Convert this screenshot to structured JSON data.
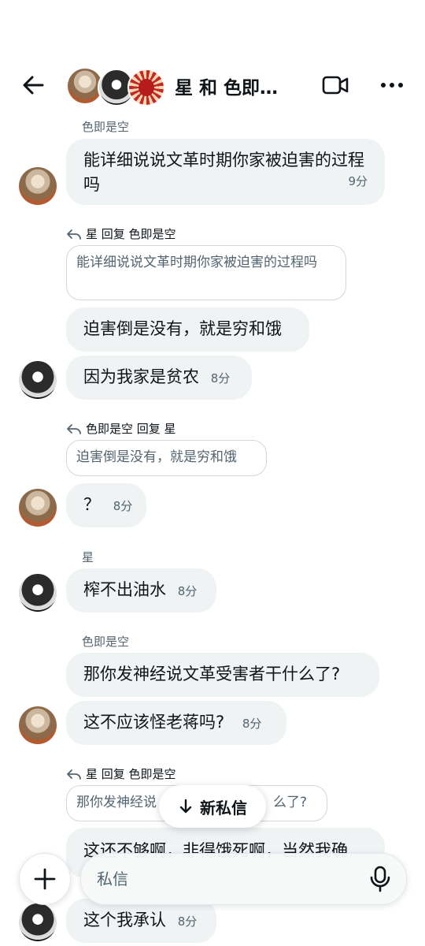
{
  "header": {
    "title": "星 和 色即…"
  },
  "composer": {
    "placeholder": "私信"
  },
  "new_messages_button": "新私信",
  "messages": [
    {
      "sender_label": "色即是空"
    },
    {
      "text": "能详细说说文革时期你家被迫害的过程吗",
      "time": "9分"
    },
    {
      "reply_label": "星 回复 色即是空",
      "quote": "能详细说说文革时期你家被迫害的过程吗"
    },
    {
      "text": "迫害倒是没有，就是穷和饿"
    },
    {
      "text": "因为我家是贫农",
      "time": "8分"
    },
    {
      "reply_label": "色即是空 回复 星",
      "quote": "迫害倒是没有，就是穷和饿"
    },
    {
      "text": "？",
      "time": "8分"
    },
    {
      "sender_label": "星"
    },
    {
      "text": "榨不出油水",
      "time": "8分"
    },
    {
      "sender_label": "色即是空"
    },
    {
      "text": "那你发神经说文革受害者干什么了?"
    },
    {
      "text": "这不应该怪老蒋吗?",
      "time": "8分"
    },
    {
      "reply_label": "星 回复 色即是空",
      "quote_left": "那你发神经说",
      "quote_right": "么了?"
    },
    {
      "text_partial": "这还不够啊，非得饿死啊，当然我确"
    },
    {
      "text": "这个我承认",
      "time": "8分"
    }
  ],
  "colors": {
    "bubble": "#eff3f4",
    "secondary_text": "#536471",
    "quote_border": "#cfd9de"
  }
}
